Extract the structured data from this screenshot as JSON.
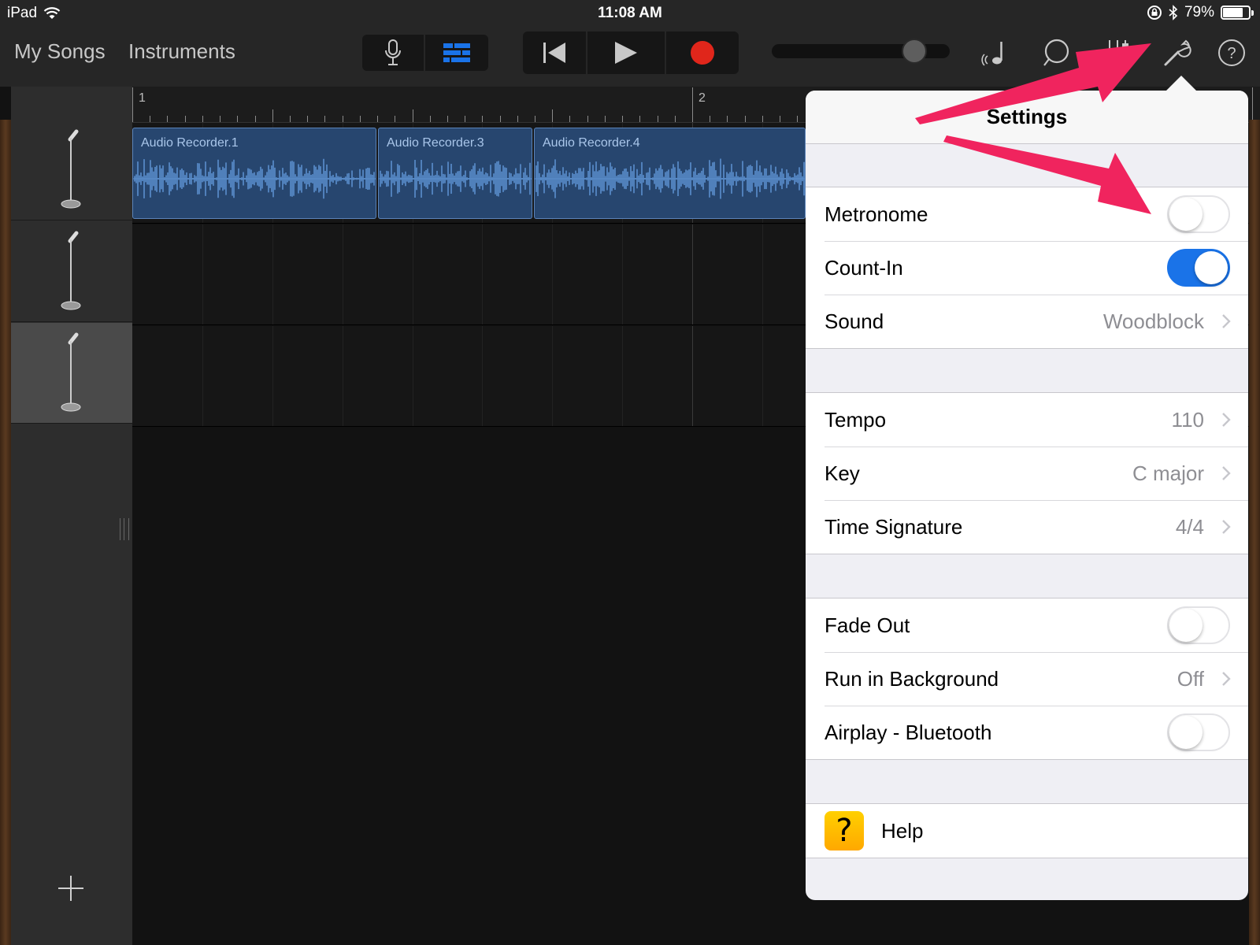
{
  "status_bar": {
    "device": "iPad",
    "time": "11:08 AM",
    "battery": "79%",
    "battery_level": 0.79
  },
  "toolbar": {
    "nav": [
      "My Songs",
      "Instruments"
    ],
    "view_buttons": [
      {
        "icon": "microphone-icon",
        "selected": false
      },
      {
        "icon": "tracks-view-icon",
        "selected": true
      }
    ],
    "transport": [
      {
        "icon": "go-to-beginning-icon"
      },
      {
        "icon": "play-icon"
      },
      {
        "icon": "record-icon"
      }
    ],
    "master_volume_level": 0.8,
    "right_icons": [
      "metronome-icon",
      "loop-icon",
      "mixer-icon",
      "wrench-icon",
      "help-icon"
    ]
  },
  "timeline": {
    "bar_numbers": [
      "1",
      "2"
    ],
    "regions": [
      {
        "label": "Audio Recorder.1"
      },
      {
        "label": "Audio Recorder.3"
      },
      {
        "label": "Audio Recorder.4"
      }
    ],
    "tracks": [
      {
        "icon": "microphone-stand-icon",
        "selected": false
      },
      {
        "icon": "microphone-stand-icon",
        "selected": false
      },
      {
        "icon": "microphone-stand-icon",
        "selected": true
      }
    ]
  },
  "settings": {
    "title": "Settings",
    "metronome_group": [
      {
        "label": "Metronome",
        "type": "toggle",
        "on": false
      },
      {
        "label": "Count-In",
        "type": "toggle",
        "on": true
      },
      {
        "label": "Sound",
        "type": "disclosure",
        "value": "Woodblock"
      }
    ],
    "song_group": [
      {
        "label": "Tempo",
        "type": "disclosure",
        "value": "110"
      },
      {
        "label": "Key",
        "type": "disclosure",
        "value": "C major"
      },
      {
        "label": "Time Signature",
        "type": "disclosure",
        "value": "4/4"
      }
    ],
    "other_group": [
      {
        "label": "Fade Out",
        "type": "toggle",
        "on": false
      },
      {
        "label": "Run in Background",
        "type": "disclosure",
        "value": "Off"
      },
      {
        "label": "Airplay - Bluetooth",
        "type": "toggle",
        "on": false
      }
    ],
    "help": {
      "label": "Help",
      "icon_glyph": "?"
    }
  },
  "colors": {
    "accent_blue": "#1a73e8",
    "record_red": "#e0261b",
    "annotation_pink": "#f0245e",
    "region_blue": "#27466f",
    "waveform": "#5b8fce"
  }
}
